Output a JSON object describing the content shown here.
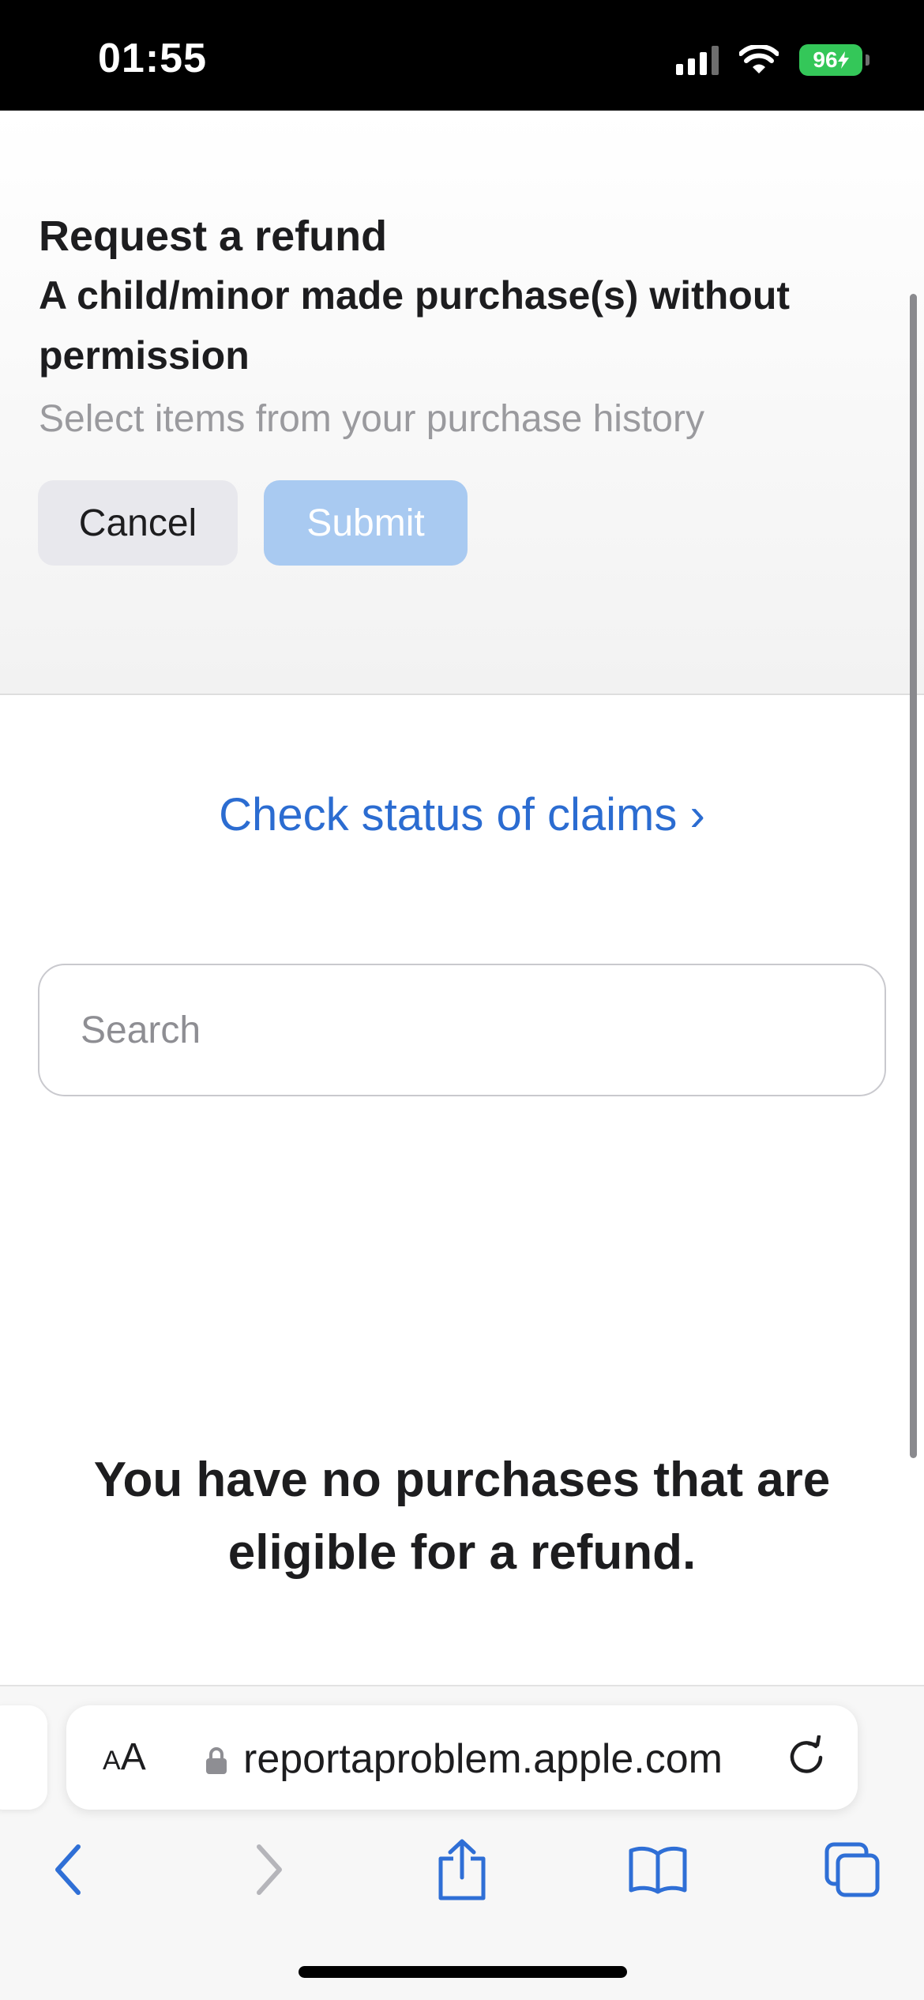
{
  "status_bar": {
    "time": "01:55",
    "battery": "96",
    "icons": [
      "cellular-signal-icon",
      "wifi-icon",
      "battery-charging-icon"
    ]
  },
  "header": {
    "title": "Request a refund",
    "subtitle": "A child/minor made purchase(s) without permission",
    "instruction": "Select items from your purchase history",
    "cancel_label": "Cancel",
    "submit_label": "Submit"
  },
  "main": {
    "check_status_link": "Check status of claims ›",
    "search_placeholder": "Search",
    "empty_message": "You have no purchases that are eligible for a refund."
  },
  "browser": {
    "aa_label_small": "A",
    "aa_label_large": "A",
    "url": "reportaproblem.apple.com",
    "toolbar_icons": [
      "back-icon",
      "forward-icon",
      "share-icon",
      "bookmarks-icon",
      "tabs-icon"
    ]
  },
  "colors": {
    "link_blue": "#2b6cd1",
    "submit_disabled": "#a9caf1",
    "battery_green": "#34c759",
    "toolbar_blue": "#2f6fd6",
    "toolbar_disabled": "#b5b5ba"
  }
}
